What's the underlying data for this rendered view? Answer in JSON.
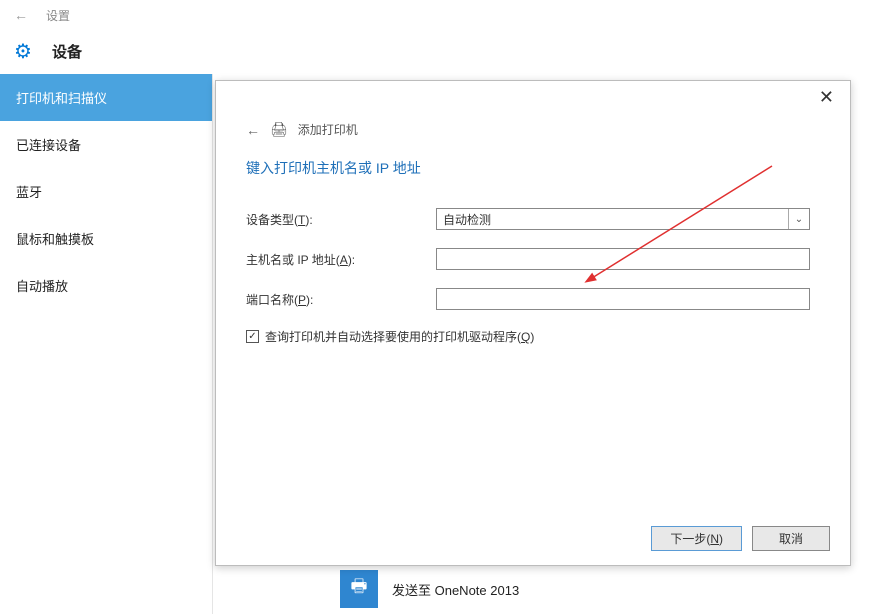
{
  "topbar": {
    "settings_label": "设置"
  },
  "header": {
    "title": "设备"
  },
  "sidebar": {
    "items": [
      {
        "label": "打印机和扫描仪"
      },
      {
        "label": "已连接设备"
      },
      {
        "label": "蓝牙"
      },
      {
        "label": "鼠标和触摸板"
      },
      {
        "label": "自动播放"
      }
    ]
  },
  "dialog": {
    "header_text": "添加打印机",
    "title": "键入打印机主机名或 IP 地址",
    "device_type_label_pre": "设备类型(",
    "device_type_label_u": "T",
    "device_type_label_post": "):",
    "device_type_value": "自动检测",
    "hostname_label_pre": "主机名或 IP 地址(",
    "hostname_label_u": "A",
    "hostname_label_post": "):",
    "hostname_value": "",
    "port_label_pre": "端口名称(",
    "port_label_u": "P",
    "port_label_post": "):",
    "port_value": "",
    "checkbox_label_pre": "查询打印机并自动选择要使用的打印机驱动程序(",
    "checkbox_label_u": "Q",
    "checkbox_label_post": ")",
    "checkbox_checked": "✓",
    "next_button_pre": "下一步(",
    "next_button_u": "N",
    "next_button_post": ")",
    "cancel_button": "取消"
  },
  "bottom": {
    "text": "发送至 OneNote 2013"
  }
}
